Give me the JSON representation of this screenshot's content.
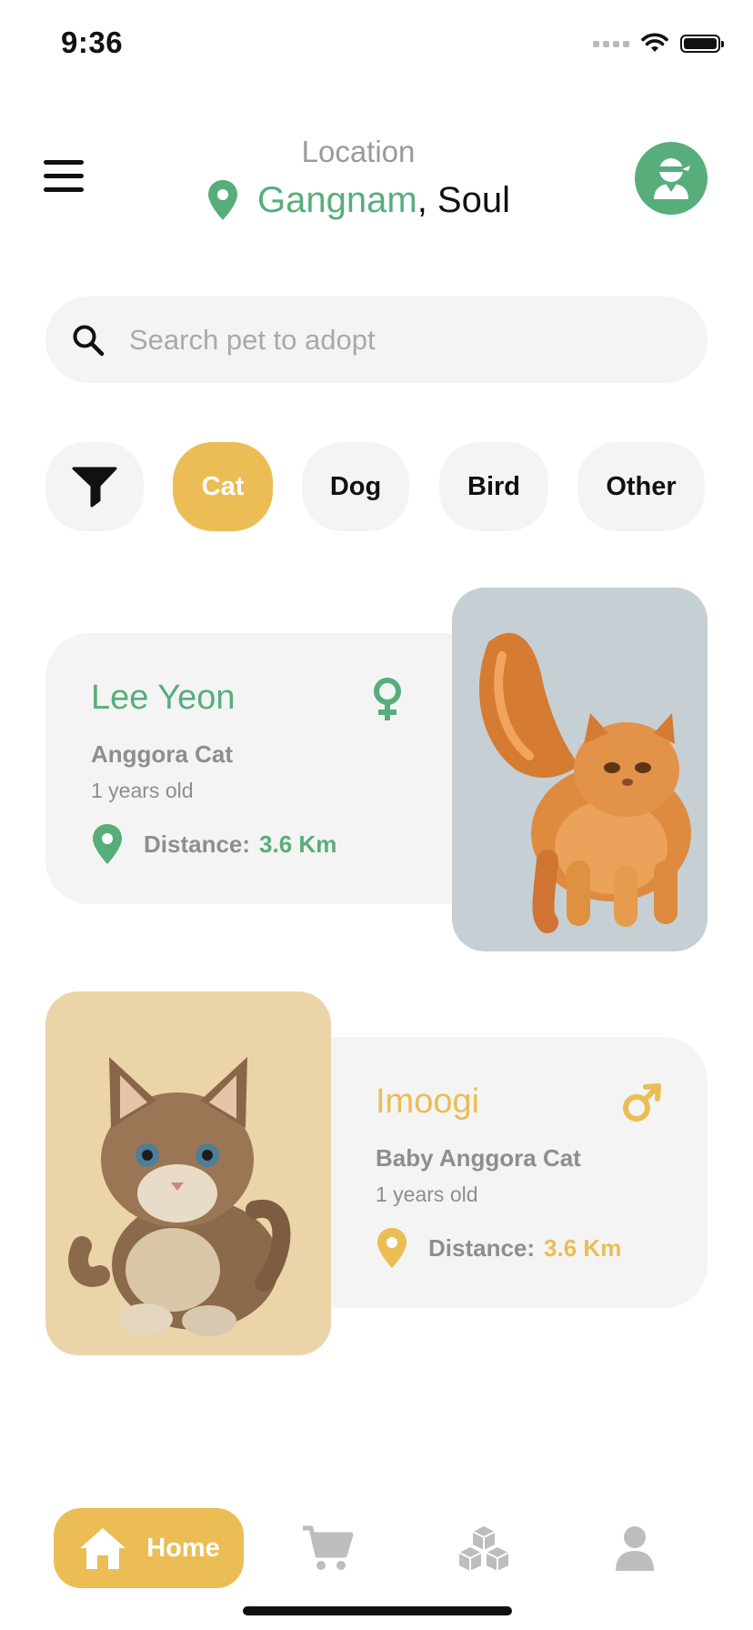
{
  "status_bar": {
    "time": "9:36"
  },
  "header": {
    "location_label": "Location",
    "location_city": "Gangnam",
    "location_rest": ", Soul"
  },
  "search": {
    "placeholder": "Search pet to adopt",
    "value": ""
  },
  "filters": {
    "items": [
      {
        "label": "Cat",
        "active": true
      },
      {
        "label": "Dog",
        "active": false
      },
      {
        "label": "Bird",
        "active": false
      },
      {
        "label": "Other",
        "active": false
      }
    ]
  },
  "pets": [
    {
      "name": "Lee Yeon",
      "breed": "Anggora Cat",
      "age": "1 years old",
      "distance_label": "Distance:",
      "distance_value": "3.6 Km",
      "gender": "female",
      "gender_icon": "female-icon",
      "accent_color": "#57ae7b",
      "photo_bg": "#c6cfd4"
    },
    {
      "name": "Imoogi",
      "breed": "Baby Anggora Cat",
      "age": "1 years old",
      "distance_label": "Distance:",
      "distance_value": "3.6 Km",
      "gender": "male",
      "gender_icon": "male-icon",
      "accent_color": "#ecbd55",
      "photo_bg": "#ecd4a9"
    }
  ],
  "bottom_nav": {
    "active": "Home",
    "home_label": "Home",
    "icons": [
      "home-icon",
      "cart-icon",
      "cubes-icon",
      "profile-icon"
    ]
  },
  "colors": {
    "primary_green": "#57ae7b",
    "accent_yellow": "#ecbd55",
    "card_bg": "#f4f4f4",
    "muted_text": "#8e8e8e"
  }
}
